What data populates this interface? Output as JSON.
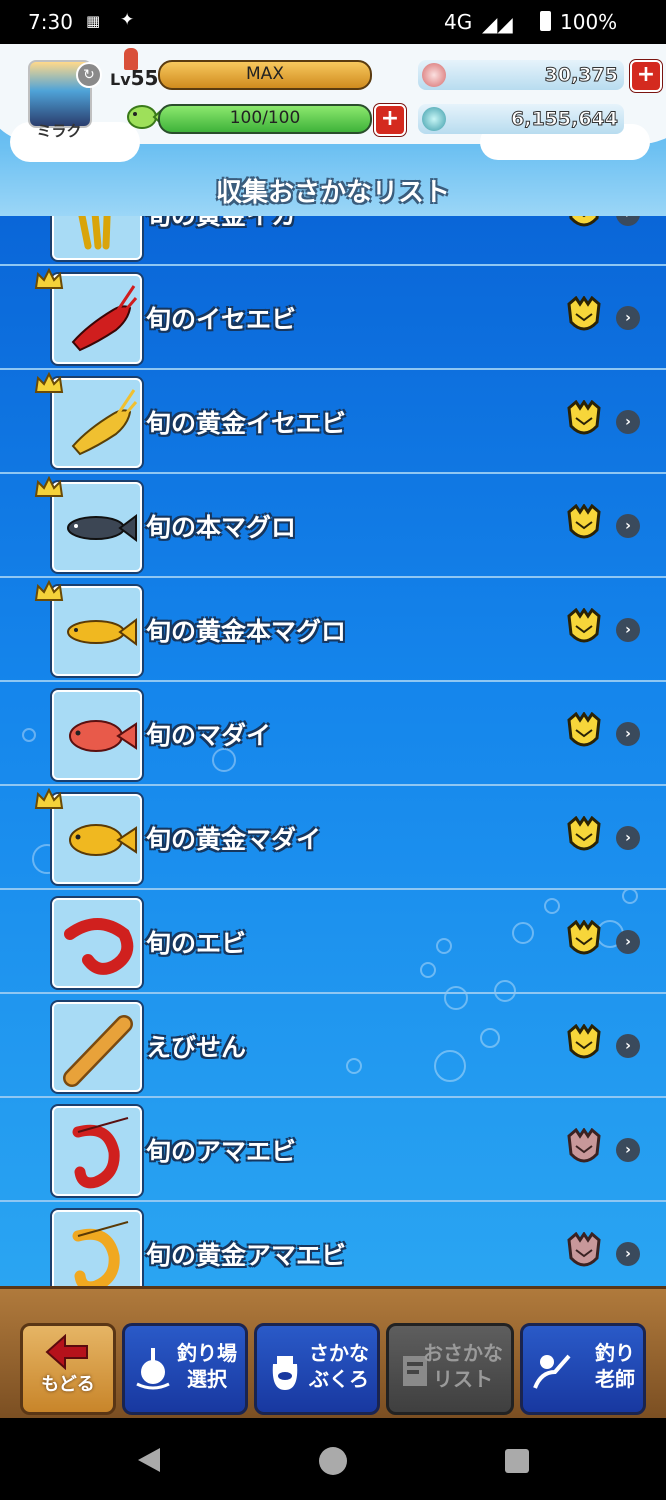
{
  "status_bar": {
    "time": "7:30",
    "network": "4G",
    "battery": "100%"
  },
  "profile": {
    "name": "ミラク",
    "level_prefix": "Lv",
    "level": "55",
    "exp_label": "MAX"
  },
  "stamina": {
    "value_label": "100/100",
    "fill_fraction": 1.0
  },
  "currency": {
    "gems": "30,375",
    "coins": "6,155,644"
  },
  "page_title": "収集おさかなリスト",
  "items": [
    {
      "name": "旬の黄金イカ",
      "crown": false,
      "medal": "gold",
      "icon": "golden-squid-icon"
    },
    {
      "name": "旬のイセエビ",
      "crown": true,
      "medal": "gold",
      "icon": "spiny-lobster-icon"
    },
    {
      "name": "旬の黄金イセエビ",
      "crown": true,
      "medal": "gold",
      "icon": "golden-spiny-lobster-icon"
    },
    {
      "name": "旬の本マグロ",
      "crown": true,
      "medal": "gold",
      "icon": "bluefin-tuna-icon"
    },
    {
      "name": "旬の黄金本マグロ",
      "crown": true,
      "medal": "gold",
      "icon": "golden-bluefin-tuna-icon"
    },
    {
      "name": "旬のマダイ",
      "crown": false,
      "medal": "gold",
      "icon": "red-seabream-icon"
    },
    {
      "name": "旬の黄金マダイ",
      "crown": true,
      "medal": "gold",
      "icon": "golden-seabream-icon"
    },
    {
      "name": "旬のエビ",
      "crown": false,
      "medal": "gold",
      "icon": "shrimp-icon"
    },
    {
      "name": "えびせん",
      "crown": false,
      "medal": "gold",
      "icon": "shrimp-cracker-icon"
    },
    {
      "name": "旬のアマエビ",
      "crown": false,
      "medal": "bronze",
      "icon": "sweet-shrimp-icon"
    },
    {
      "name": "旬の黄金アマエビ",
      "crown": false,
      "medal": "bronze",
      "icon": "golden-sweet-shrimp-icon"
    }
  ],
  "nav": {
    "back": "もどる",
    "spot_1": "釣り場",
    "spot_2": "選択",
    "bag_1": "さかな",
    "bag_2": "ぶくろ",
    "list_1": "おさかな",
    "list_2": "リスト",
    "teacher_1": "釣り",
    "teacher_2": "老師"
  },
  "colors": {
    "list_top": "#0a66d8",
    "list_bottom": "#2aa5f2",
    "plus_button": "#d42a1f"
  }
}
